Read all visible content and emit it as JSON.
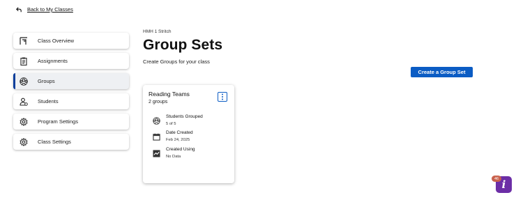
{
  "back_link": {
    "label": "Back to My Classes"
  },
  "sidebar": {
    "items": [
      {
        "label": "Class Overview",
        "icon": "class-overview-icon",
        "active": false
      },
      {
        "label": "Assignments",
        "icon": "clipboard-icon",
        "active": false
      },
      {
        "label": "Groups",
        "icon": "groups-icon",
        "active": true
      },
      {
        "label": "Students",
        "icon": "students-icon",
        "active": false
      },
      {
        "label": "Program Settings",
        "icon": "gear-icon",
        "active": false
      },
      {
        "label": "Class Settings",
        "icon": "gear-icon",
        "active": false
      }
    ]
  },
  "main": {
    "breadcrumb": "HMH 1 Stritch",
    "title": "Group Sets",
    "subtitle": "Create Groups for your class",
    "create_button": "Create a Group Set"
  },
  "card": {
    "title": "Reading Teams",
    "subtitle": "2 groups",
    "stats": [
      {
        "label": "Students Grouped",
        "value": "5 of 5",
        "icon": "students-grouped-icon"
      },
      {
        "label": "Date Created",
        "value": "Feb 24, 2025",
        "icon": "calendar-icon"
      },
      {
        "label": "Created Using",
        "value": "No Data",
        "icon": "chart-icon"
      }
    ]
  },
  "help": {
    "badge": "46",
    "glyph": "i"
  },
  "colors": {
    "primary": "#0b5cc4",
    "active_indicator": "#0b3f9c",
    "help": "#6c2ea6",
    "badge": "#c9624d"
  }
}
